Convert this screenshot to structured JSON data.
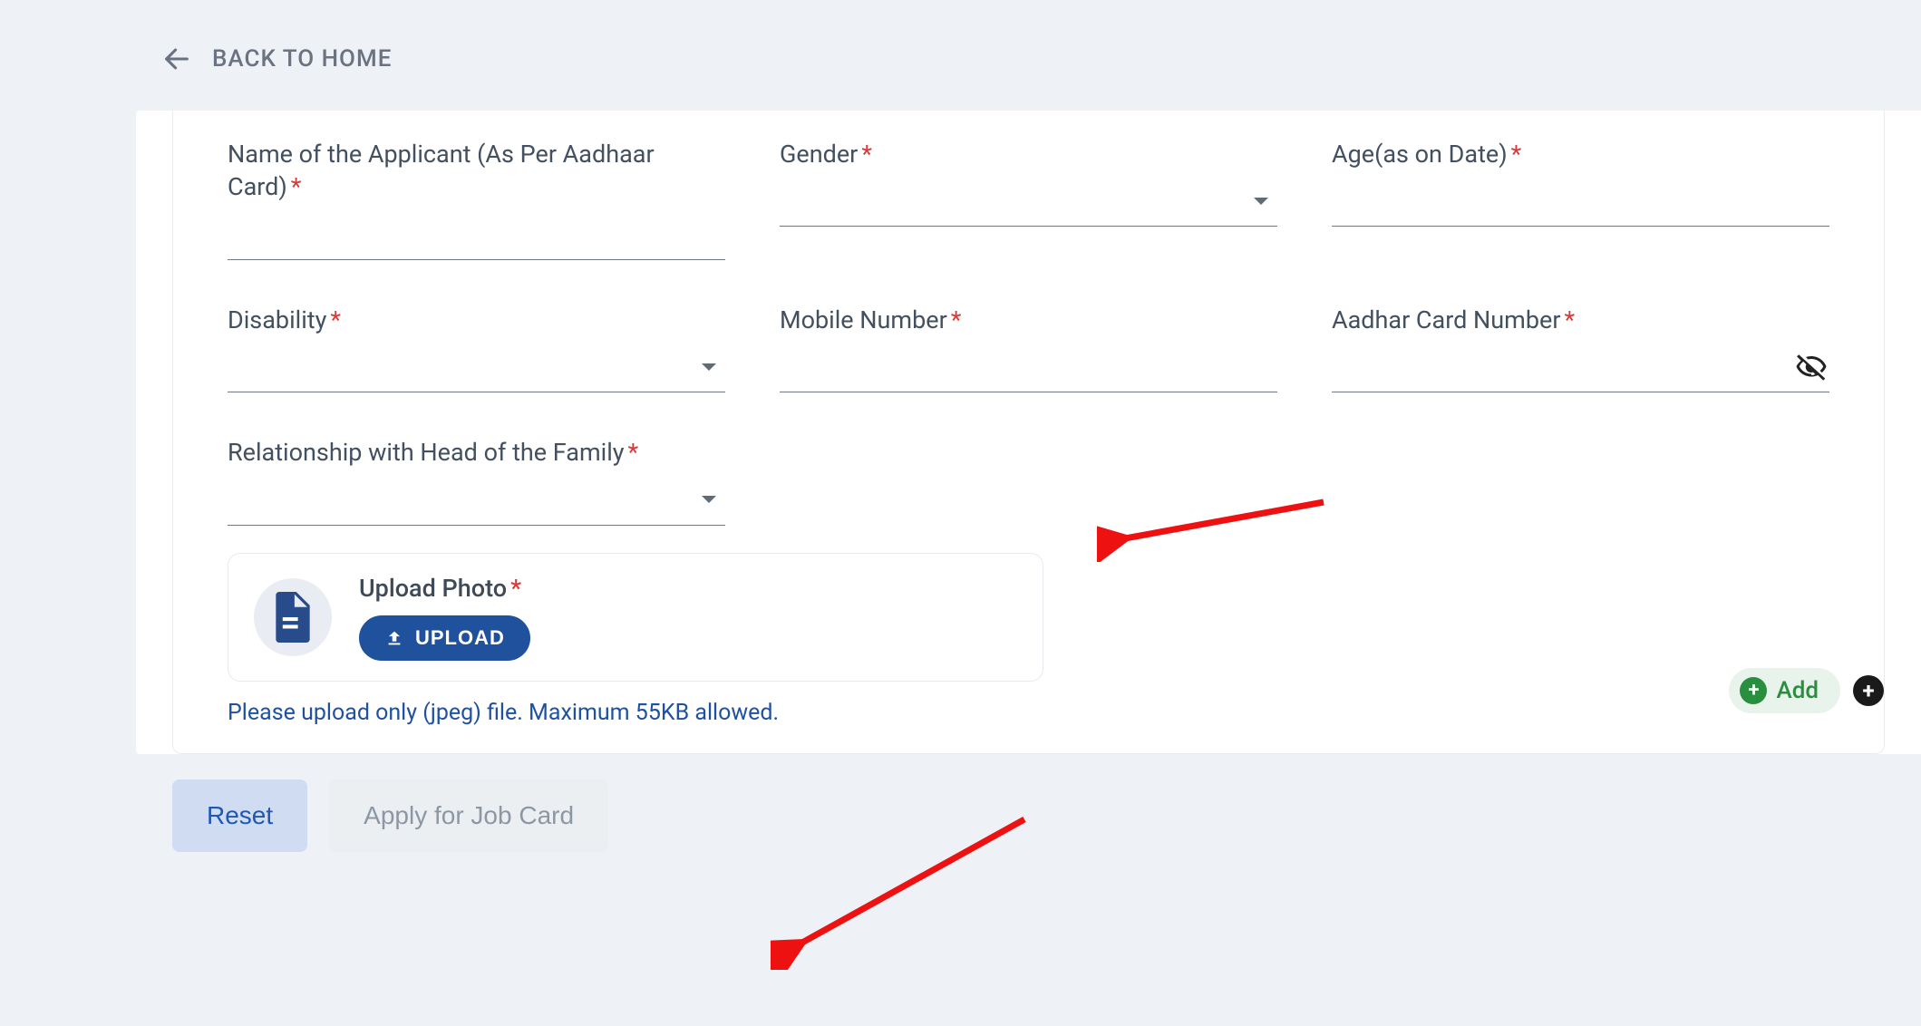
{
  "nav": {
    "back_label": "BACK TO HOME"
  },
  "fields": {
    "name": {
      "label": "Name of the Applicant (As Per Aadhaar Card)",
      "value": ""
    },
    "gender": {
      "label": "Gender",
      "value": ""
    },
    "age": {
      "label": "Age(as on Date)",
      "value": ""
    },
    "disability": {
      "label": "Disability",
      "value": ""
    },
    "mobile": {
      "label": "Mobile Number",
      "value": ""
    },
    "aadhar": {
      "label": "Aadhar Card Number",
      "value": ""
    },
    "relationship": {
      "label": "Relationship with Head of the Family",
      "value": ""
    }
  },
  "upload": {
    "title": "Upload Photo",
    "button": "UPLOAD",
    "hint": "Please upload only (jpeg) file. Maximum 55KB allowed."
  },
  "actions": {
    "add": "Add",
    "reset": "Reset",
    "apply": "Apply for Job Card"
  }
}
